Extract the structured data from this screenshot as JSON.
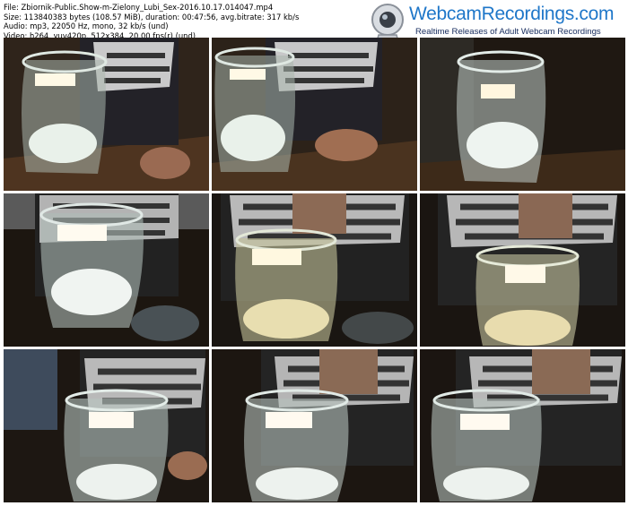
{
  "file_info": {
    "file_line": "File: Zbiornik-Public.Show-m-Zielony_Lubi_Sex-2016.10.17.014047.mp4",
    "size_line": "Size: 113840383 bytes (108.57 MiB), duration: 00:47:56, avg.bitrate: 317 kb/s",
    "audio_line": "Audio: mp3, 22050 Hz, mono, 32 kb/s (und)",
    "video_line": "Video: h264, yuv420p, 512x384, 20.00 fps(r) (und)"
  },
  "logo": {
    "name": "WebcamRecordings.com",
    "tagline": "Realtime Releases of Adult Webcam Recordings",
    "icon": "webcam-icon"
  },
  "frames": [
    {
      "id": "frame-1"
    },
    {
      "id": "frame-2"
    },
    {
      "id": "frame-3"
    },
    {
      "id": "frame-4"
    },
    {
      "id": "frame-5"
    },
    {
      "id": "frame-6"
    },
    {
      "id": "frame-7"
    },
    {
      "id": "frame-8"
    },
    {
      "id": "frame-9"
    }
  ]
}
